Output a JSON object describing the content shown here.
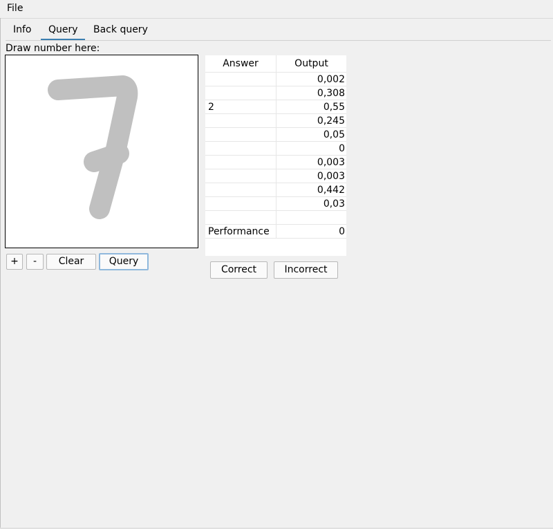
{
  "menubar": {
    "file_label": "File"
  },
  "tabs": [
    {
      "label": "Info"
    },
    {
      "label": "Query",
      "active": true
    },
    {
      "label": "Back query"
    }
  ],
  "draw_area": {
    "label": "Draw number here:",
    "stroke_color": "#c0c0c0"
  },
  "canvas_buttons": {
    "plus": "+",
    "minus": "-",
    "clear": "Clear",
    "query": "Query"
  },
  "results": {
    "headers": {
      "answer": "Answer",
      "output": "Output"
    },
    "rows": [
      {
        "answer": "",
        "output": "0,002"
      },
      {
        "answer": "",
        "output": "0,308"
      },
      {
        "answer": "2",
        "output": "0,55"
      },
      {
        "answer": "",
        "output": "0,245"
      },
      {
        "answer": "",
        "output": "0,05"
      },
      {
        "answer": "",
        "output": "0"
      },
      {
        "answer": "",
        "output": "0,003"
      },
      {
        "answer": "",
        "output": "0,003"
      },
      {
        "answer": "",
        "output": "0,442"
      },
      {
        "answer": "",
        "output": "0,03"
      },
      {
        "answer": "",
        "output": ""
      },
      {
        "answer": "Performance",
        "output": "0"
      }
    ]
  },
  "feedback_buttons": {
    "correct": "Correct",
    "incorrect": "Incorrect"
  },
  "colors": {
    "tab_accent": "#3c7fb1",
    "focus_border": "#8fb8dc"
  }
}
